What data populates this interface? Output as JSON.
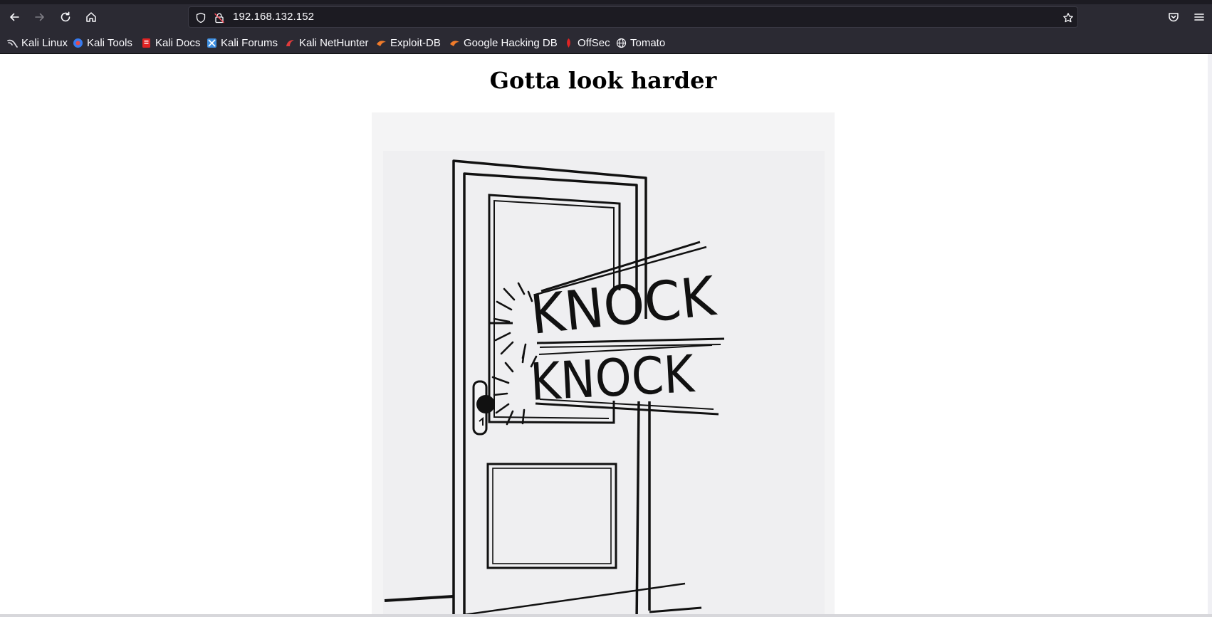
{
  "browser": {
    "url": "192.168.132.152",
    "bookmarks": [
      {
        "label": "Kali Linux",
        "icon": "kali-dragon-icon"
      },
      {
        "label": "Kali Tools",
        "icon": "kali-tools-icon"
      },
      {
        "label": "Kali Docs",
        "icon": "kali-docs-icon"
      },
      {
        "label": "Kali Forums",
        "icon": "kali-forums-icon"
      },
      {
        "label": "Kali NetHunter",
        "icon": "nethunter-icon"
      },
      {
        "label": "Exploit-DB",
        "icon": "exploit-db-icon"
      },
      {
        "label": "Google Hacking DB",
        "icon": "ghdb-icon"
      },
      {
        "label": "OffSec",
        "icon": "offsec-icon"
      },
      {
        "label": "Tomato",
        "icon": "globe-icon"
      }
    ]
  },
  "page": {
    "heading": "Gotta look harder",
    "image_text": [
      "KNOCK",
      "KNOCK"
    ]
  },
  "colors": {
    "chrome": "#2b2a33",
    "urlbar": "#1c1b22",
    "text_light": "#fbfbfe",
    "page_bg": "#ffffff"
  }
}
